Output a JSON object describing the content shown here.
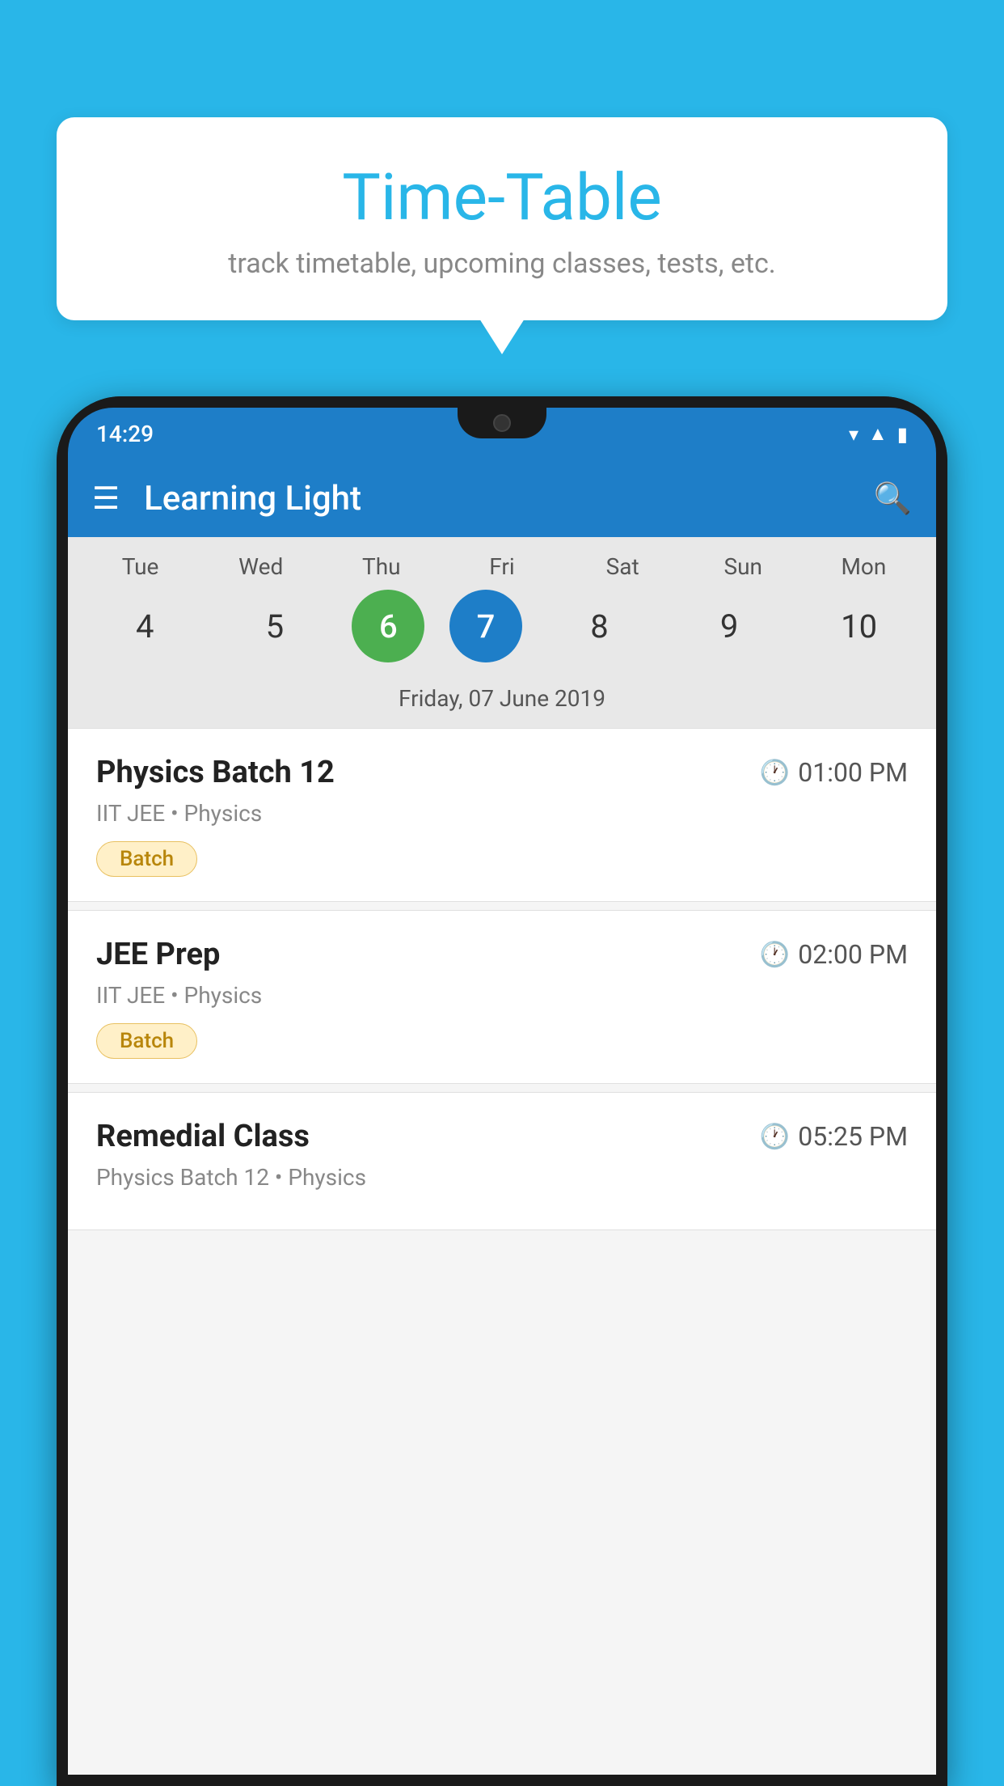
{
  "background_color": "#29B6E8",
  "speech_bubble": {
    "title": "Time-Table",
    "subtitle": "track timetable, upcoming classes, tests, etc."
  },
  "status_bar": {
    "time": "14:29",
    "wifi_icon": "▲",
    "signal_icon": "▲",
    "battery_icon": "▮"
  },
  "app_bar": {
    "title": "Learning Light",
    "menu_icon": "☰",
    "search_icon": "🔍"
  },
  "calendar": {
    "days": [
      {
        "name": "Tue",
        "num": "4"
      },
      {
        "name": "Wed",
        "num": "5"
      },
      {
        "name": "Thu",
        "num": "6",
        "state": "today"
      },
      {
        "name": "Fri",
        "num": "7",
        "state": "selected"
      },
      {
        "name": "Sat",
        "num": "8"
      },
      {
        "name": "Sun",
        "num": "9"
      },
      {
        "name": "Mon",
        "num": "10"
      }
    ],
    "selected_date_label": "Friday, 07 June 2019"
  },
  "events": [
    {
      "title": "Physics Batch 12",
      "time": "01:00 PM",
      "subtitle": "IIT JEE • Physics",
      "badge": "Batch"
    },
    {
      "title": "JEE Prep",
      "time": "02:00 PM",
      "subtitle": "IIT JEE • Physics",
      "badge": "Batch"
    },
    {
      "title": "Remedial Class",
      "time": "05:25 PM",
      "subtitle": "Physics Batch 12 • Physics",
      "badge": null
    }
  ]
}
